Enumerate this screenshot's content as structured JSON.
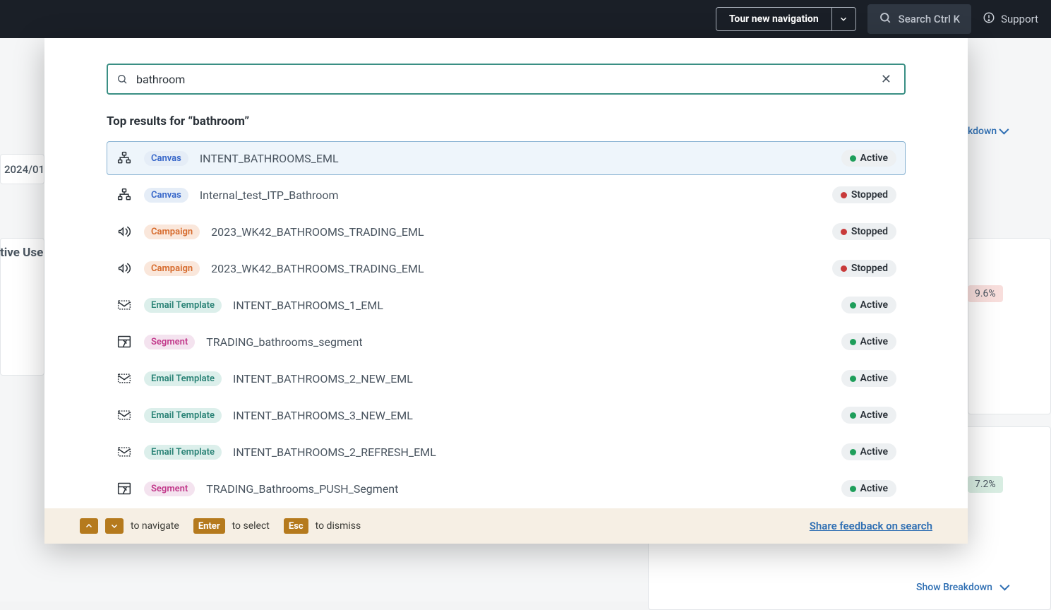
{
  "topbar": {
    "tour_label": "Tour new navigation",
    "search_label": "Search Ctrl K",
    "support_label": "Support"
  },
  "bg": {
    "date": "2024/01/",
    "card_title": "tive Use",
    "breakdown1": "kdown",
    "breakdown2": "kdown",
    "badge1": "9.6%",
    "badge2": "7.2%",
    "show_breakdown": "Show Breakdown"
  },
  "search": {
    "query": "bathroom",
    "heading": "Top results for “bathroom”"
  },
  "type_pills": {
    "canvas": "Canvas",
    "campaign": "Campaign",
    "email": "Email Template",
    "segment": "Segment"
  },
  "status": {
    "active": "Active",
    "stopped": "Stopped"
  },
  "results": [
    {
      "type": "canvas",
      "name": "INTENT_BATHROOMS_EML",
      "status": "active",
      "selected": true
    },
    {
      "type": "canvas",
      "name": "Internal_test_ITP_Bathroom",
      "status": "stopped",
      "selected": false
    },
    {
      "type": "campaign",
      "name": "2023_WK42_BATHROOMS_TRADING_EML",
      "status": "stopped",
      "selected": false
    },
    {
      "type": "campaign",
      "name": "2023_WK42_BATHROOMS_TRADING_EML",
      "status": "stopped",
      "selected": false
    },
    {
      "type": "email",
      "name": "INTENT_BATHROOMS_1_EML",
      "status": "active",
      "selected": false
    },
    {
      "type": "segment",
      "name": "TRADING_bathrooms_segment",
      "status": "active",
      "selected": false
    },
    {
      "type": "email",
      "name": "INTENT_BATHROOMS_2_NEW_EML",
      "status": "active",
      "selected": false
    },
    {
      "type": "email",
      "name": "INTENT_BATHROOMS_3_NEW_EML",
      "status": "active",
      "selected": false
    },
    {
      "type": "email",
      "name": "INTENT_BATHROOMS_2_REFRESH_EML",
      "status": "active",
      "selected": false
    },
    {
      "type": "segment",
      "name": "TRADING_Bathrooms_PUSH_Segment",
      "status": "active",
      "selected": false
    }
  ],
  "footer": {
    "navigate": "to navigate",
    "enter": "Enter",
    "select": "to select",
    "esc": "Esc",
    "dismiss": "to dismiss",
    "feedback": "Share feedback on search"
  }
}
